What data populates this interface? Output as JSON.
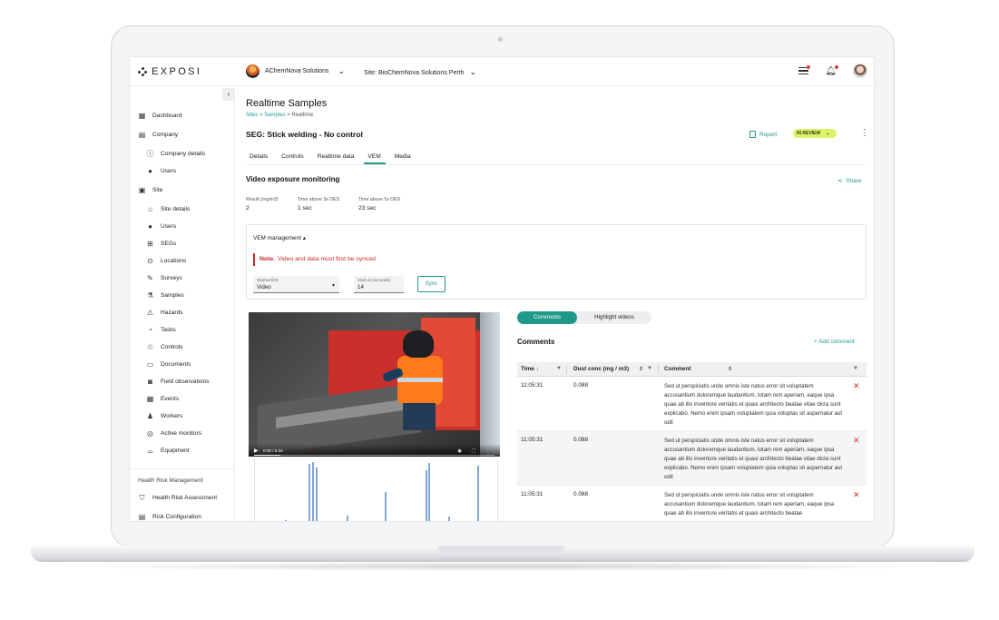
{
  "app": {
    "logo_text": "EXPOSI",
    "org_name": "AChemNova Solutions",
    "site_label": "Site: BioChemNova Solutions Perth"
  },
  "sidebar": {
    "items": [
      {
        "label": "Dashboard",
        "icon": "dashboard-icon"
      },
      {
        "label": "Company",
        "icon": "building-icon"
      },
      {
        "label": "Company details",
        "icon": "info-icon"
      },
      {
        "label": "Users",
        "icon": "user-icon"
      },
      {
        "label": "Site",
        "icon": "site-icon"
      },
      {
        "label": "Site details",
        "icon": "home-icon"
      },
      {
        "label": "Users",
        "icon": "user-icon"
      },
      {
        "label": "SEGs",
        "icon": "group-icon"
      },
      {
        "label": "Locations",
        "icon": "pin-icon"
      },
      {
        "label": "Surveys",
        "icon": "survey-icon"
      },
      {
        "label": "Samples",
        "icon": "flask-icon"
      },
      {
        "label": "Hazards",
        "icon": "hazard-icon"
      },
      {
        "label": "Tasks",
        "icon": "task-icon"
      },
      {
        "label": "Controls",
        "icon": "controls-icon"
      },
      {
        "label": "Documents",
        "icon": "document-icon"
      },
      {
        "label": "Field observations",
        "icon": "camera-icon"
      },
      {
        "label": "Events",
        "icon": "calendar-icon"
      },
      {
        "label": "Workers",
        "icon": "worker-icon"
      },
      {
        "label": "Active monitors",
        "icon": "monitor-icon"
      },
      {
        "label": "Equipment",
        "icon": "equipment-icon"
      }
    ],
    "section_label": "Health Risk Management",
    "section_items": [
      {
        "label": "Health Risk Assessment",
        "icon": "shield-icon"
      },
      {
        "label": "Risk Configuration",
        "icon": "config-icon"
      }
    ]
  },
  "page": {
    "title": "Realtime Samples",
    "breadcrumb": {
      "sites": "Sites",
      "samples": "Samples",
      "current": "Realtime",
      "sep": ">"
    },
    "seg_title": "SEG: Stick welding -  No control",
    "report_label": "Report",
    "status": "IN REVIEW",
    "tabs": [
      "Details",
      "Controls",
      "Realtime data",
      "VEM",
      "Media"
    ],
    "active_tab": "VEM",
    "section_title": "Video exposure monitoring",
    "share_label": "Share",
    "metrics": [
      {
        "label": "Result (mg/m3)",
        "value": "2"
      },
      {
        "label": "Time above 3x OES",
        "value": "1 sec"
      },
      {
        "label": "Time above 5x OES",
        "value": "23 sec"
      }
    ]
  },
  "vem": {
    "header": "VEM management",
    "note_label": "Note.",
    "note_text": "Video and data must first be synced",
    "started_first_label": "Started first",
    "started_first_value": "Video",
    "start_at_label": "Start at (seconds)",
    "start_at_value": "14",
    "sync_label": "Sync"
  },
  "video": {
    "time": "0:00 / 9:34",
    "progress": 0.11
  },
  "mini_chart": {
    "bars": [
      0.05,
      0.95,
      0.98,
      0.9,
      0.12,
      0.5,
      0.85,
      0.97,
      0.1,
      0.92
    ]
  },
  "comments": {
    "tabs": [
      "Comments",
      "Highlight videos"
    ],
    "title": "Comments",
    "add_label": "Add comment",
    "columns": [
      "Time",
      "Dust conc (mg / m3)",
      "Comment"
    ],
    "rows": [
      {
        "time": "11:05:31",
        "dust": "0.088",
        "comment": "Sed ut perspiciatis unde omnis iste natus error sit voluptatem accusantium doloremque laudantium, totam rem aperiam, eaque ipsa quae ab illo inventore veritatis et quasi architecto beatae vitae dicta sunt explicabo. Nemo enim ipsam voluptatem quia voluptas sit aspernatur aut odit"
      },
      {
        "time": "11:05:31",
        "dust": "0.088",
        "comment": "Sed ut perspiciatis unde omnis iste natus error sit voluptatem accusantium doloremque laudantium, totam rem aperiam, eaque ipsa quae ab illo inventore veritatis et quasi architecto beatae vitae dicta sunt explicabo. Nemo enim ipsam voluptatem quia voluptas sit aspernatur aut odit"
      },
      {
        "time": "11:05:31",
        "dust": "0.088",
        "comment": "Sed ut perspiciatis unde omnis iste natus error sit voluptatem accusantium doloremque laudantium, totam rem aperiam, eaque ipsa quae ab illo inventore veritatis et quasi architecto beatae"
      }
    ]
  },
  "colors": {
    "accent": "#1f9a8a",
    "status_pill": "#dff36a",
    "danger": "#c62828"
  }
}
